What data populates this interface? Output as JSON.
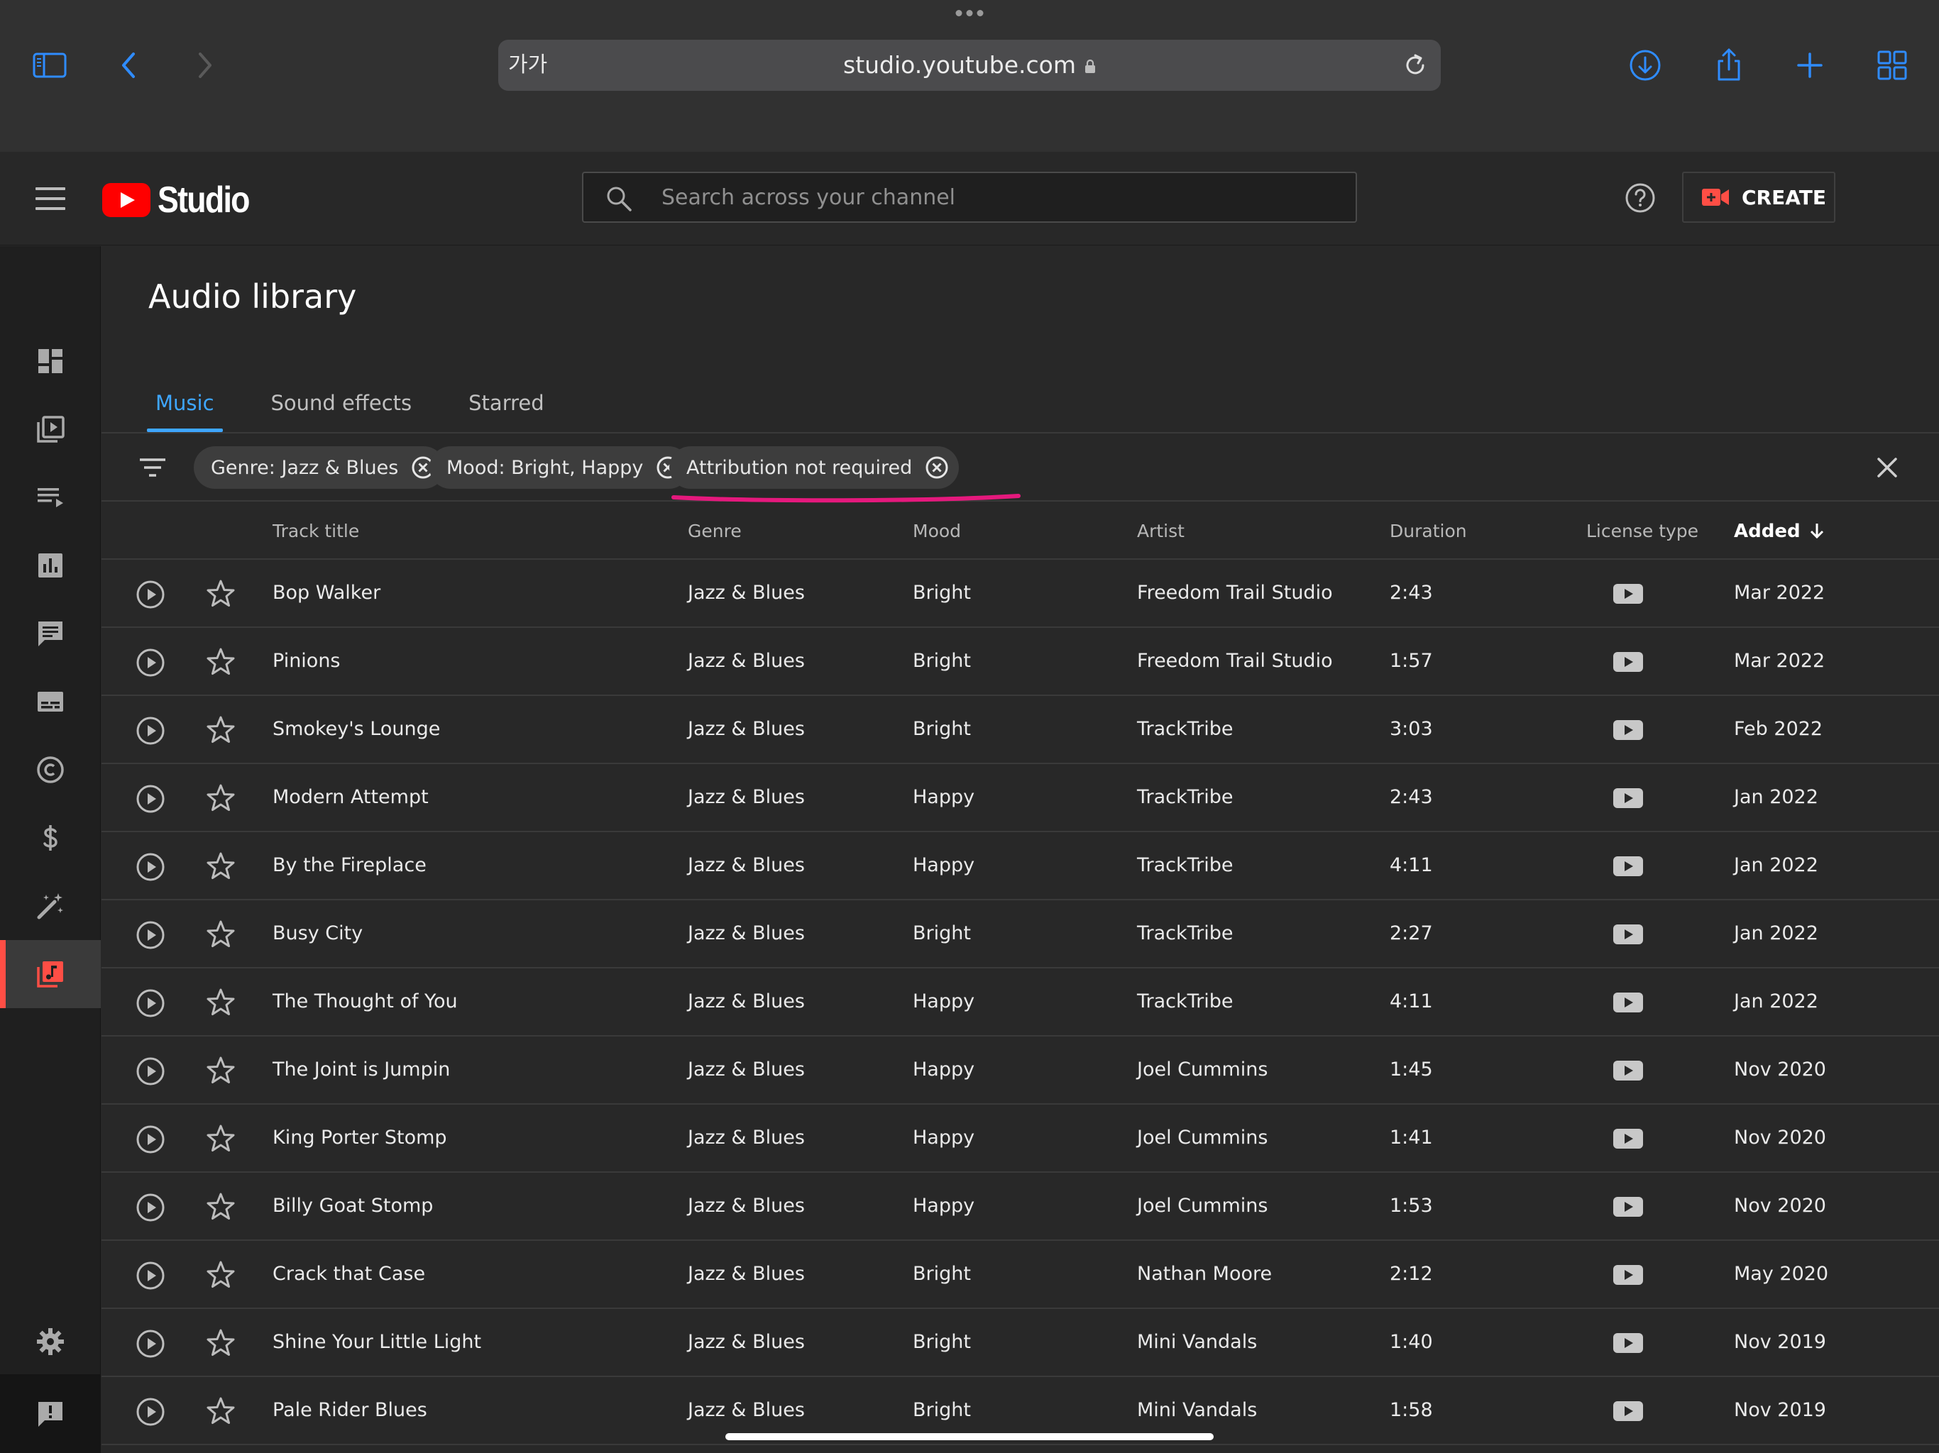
{
  "browser": {
    "text_size_label": "가가",
    "url": "studio.youtube.com"
  },
  "header": {
    "logo_text": "Studio",
    "search_placeholder": "Search across your channel",
    "create_label": "CREATE"
  },
  "page": {
    "title": "Audio library"
  },
  "tabs": [
    {
      "label": "Music",
      "active": true
    },
    {
      "label": "Sound effects",
      "active": false
    },
    {
      "label": "Starred",
      "active": false
    }
  ],
  "filters": [
    {
      "label": "Genre: Jazz & Blues"
    },
    {
      "label": "Mood: Bright, Happy"
    },
    {
      "label": "Attribution not required"
    }
  ],
  "columns": {
    "title": "Track title",
    "genre": "Genre",
    "mood": "Mood",
    "artist": "Artist",
    "duration": "Duration",
    "license": "License type",
    "added": "Added"
  },
  "accent": "#3ea6ff",
  "highlight_color": "#e5197d",
  "tracks": [
    {
      "title": "Bop Walker",
      "genre": "Jazz & Blues",
      "mood": "Bright",
      "artist": "Freedom Trail Studio",
      "duration": "2:43",
      "added": "Mar 2022"
    },
    {
      "title": "Pinions",
      "genre": "Jazz & Blues",
      "mood": "Bright",
      "artist": "Freedom Trail Studio",
      "duration": "1:57",
      "added": "Mar 2022"
    },
    {
      "title": "Smokey's Lounge",
      "genre": "Jazz & Blues",
      "mood": "Bright",
      "artist": "TrackTribe",
      "duration": "3:03",
      "added": "Feb 2022"
    },
    {
      "title": "Modern Attempt",
      "genre": "Jazz & Blues",
      "mood": "Happy",
      "artist": "TrackTribe",
      "duration": "2:43",
      "added": "Jan 2022"
    },
    {
      "title": "By the Fireplace",
      "genre": "Jazz & Blues",
      "mood": "Happy",
      "artist": "TrackTribe",
      "duration": "4:11",
      "added": "Jan 2022"
    },
    {
      "title": "Busy City",
      "genre": "Jazz & Blues",
      "mood": "Bright",
      "artist": "TrackTribe",
      "duration": "2:27",
      "added": "Jan 2022"
    },
    {
      "title": "The Thought of You",
      "genre": "Jazz & Blues",
      "mood": "Happy",
      "artist": "TrackTribe",
      "duration": "4:11",
      "added": "Jan 2022"
    },
    {
      "title": "The Joint is Jumpin",
      "genre": "Jazz & Blues",
      "mood": "Happy",
      "artist": "Joel Cummins",
      "duration": "1:45",
      "added": "Nov 2020"
    },
    {
      "title": "King Porter Stomp",
      "genre": "Jazz & Blues",
      "mood": "Happy",
      "artist": "Joel Cummins",
      "duration": "1:41",
      "added": "Nov 2020"
    },
    {
      "title": "Billy Goat Stomp",
      "genre": "Jazz & Blues",
      "mood": "Happy",
      "artist": "Joel Cummins",
      "duration": "1:53",
      "added": "Nov 2020"
    },
    {
      "title": "Crack that Case",
      "genre": "Jazz & Blues",
      "mood": "Bright",
      "artist": "Nathan Moore",
      "duration": "2:12",
      "added": "May 2020"
    },
    {
      "title": "Shine Your Little Light",
      "genre": "Jazz & Blues",
      "mood": "Bright",
      "artist": "Mini Vandals",
      "duration": "1:40",
      "added": "Nov 2019"
    },
    {
      "title": "Pale Rider Blues",
      "genre": "Jazz & Blues",
      "mood": "Bright",
      "artist": "Mini Vandals",
      "duration": "1:58",
      "added": "Nov 2019"
    }
  ]
}
